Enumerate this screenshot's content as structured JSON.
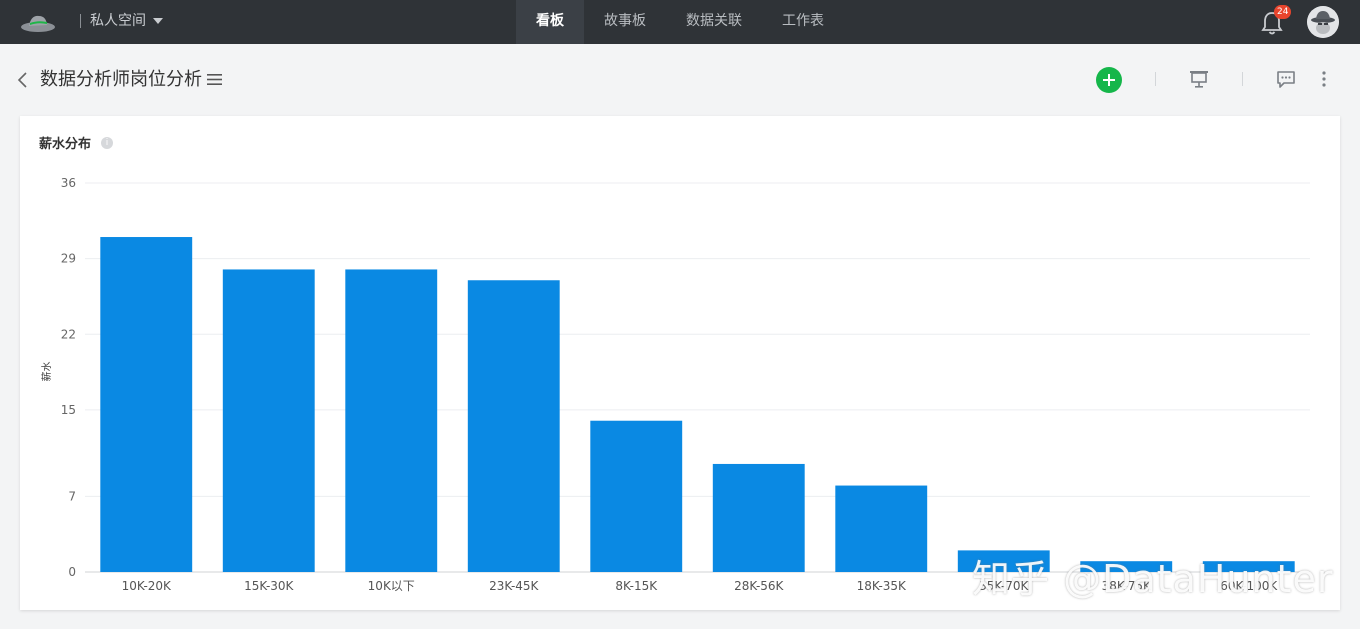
{
  "topbar": {
    "space_label": "私人空间",
    "tabs": [
      {
        "label": "看板",
        "active": true
      },
      {
        "label": "故事板",
        "active": false
      },
      {
        "label": "数据关联",
        "active": false
      },
      {
        "label": "工作表",
        "active": false
      }
    ],
    "notification_count": "24",
    "icons": [
      "logo-hat-icon",
      "caret-down-icon",
      "bell-icon",
      "avatar"
    ]
  },
  "header": {
    "title": "数据分析师岗位分析",
    "icons": [
      "back-icon",
      "menu-icon",
      "add-icon",
      "presentation-icon",
      "comment-icon",
      "more-icon"
    ]
  },
  "card": {
    "title": "薪水分布"
  },
  "chart_data": {
    "type": "bar",
    "categories": [
      "10K-20K",
      "15K-30K",
      "10K以下",
      "23K-45K",
      "8K-15K",
      "28K-56K",
      "18K-35K",
      "35K-70K",
      "38K-75K",
      "60K-100K"
    ],
    "values": [
      31,
      28,
      28,
      27,
      14,
      10,
      8,
      2,
      1,
      1
    ],
    "ylabel": "薪水",
    "yticks": [
      0,
      7,
      15,
      22,
      29,
      36
    ],
    "ylim": [
      0,
      36
    ],
    "grid": true,
    "legend": "none",
    "bar_color": "#0a89e3"
  },
  "watermark": "知乎 @DataHunter",
  "colors": {
    "topbar_bg": "#2f3337",
    "accent_green": "#15b64a",
    "badge_red": "#e8452d"
  }
}
